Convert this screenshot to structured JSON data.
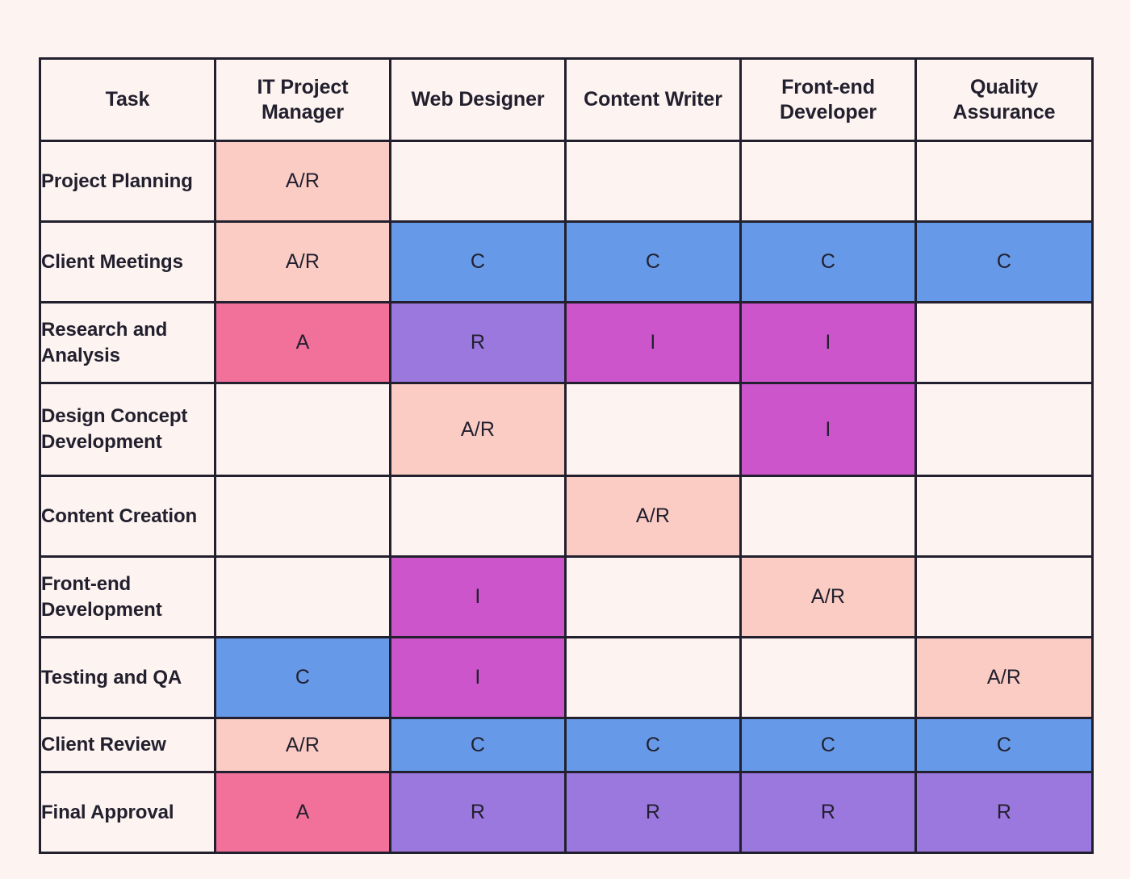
{
  "page": {
    "background_color": "#FDF3F0",
    "border_color": "#22202E",
    "text_color": "#22202E"
  },
  "legend_colors": {
    "accountable_responsible": "#FBCCC4",
    "accountable": "#F2719B",
    "responsible": "#9B78DE",
    "informed": "#CC55CC",
    "consulted": "#6699E8",
    "empty": "#FDF3F0"
  },
  "chart_data": {
    "type": "table",
    "title": "",
    "columns": [
      "Task",
      "IT Project Manager",
      "Web Designer",
      "Content Writer",
      "Front-end Developer",
      "Quality Assurance"
    ],
    "rows": [
      {
        "task": "Project Planning",
        "lines": 2,
        "cells": [
          {
            "value": "A/R",
            "code": "AR"
          },
          {
            "value": "",
            "code": "empty"
          },
          {
            "value": "",
            "code": "empty"
          },
          {
            "value": "",
            "code": "empty"
          },
          {
            "value": "",
            "code": "empty"
          }
        ]
      },
      {
        "task": "Client Meetings",
        "lines": 2,
        "cells": [
          {
            "value": "A/R",
            "code": "AR"
          },
          {
            "value": "C",
            "code": "C"
          },
          {
            "value": "C",
            "code": "C"
          },
          {
            "value": "C",
            "code": "C"
          },
          {
            "value": "C",
            "code": "C"
          }
        ]
      },
      {
        "task": "Research and Analysis",
        "lines": 2,
        "cells": [
          {
            "value": "A",
            "code": "A"
          },
          {
            "value": "R",
            "code": "R"
          },
          {
            "value": "I",
            "code": "I"
          },
          {
            "value": "I",
            "code": "I"
          },
          {
            "value": "",
            "code": "empty"
          }
        ]
      },
      {
        "task": "Design Concept Development",
        "lines": 3,
        "cells": [
          {
            "value": "",
            "code": "empty"
          },
          {
            "value": "A/R",
            "code": "AR"
          },
          {
            "value": "",
            "code": "empty"
          },
          {
            "value": "I",
            "code": "I"
          },
          {
            "value": "",
            "code": "empty"
          }
        ]
      },
      {
        "task": "Content Creation",
        "lines": 2,
        "cells": [
          {
            "value": "",
            "code": "empty"
          },
          {
            "value": "",
            "code": "empty"
          },
          {
            "value": "A/R",
            "code": "AR"
          },
          {
            "value": "",
            "code": "empty"
          },
          {
            "value": "",
            "code": "empty"
          }
        ]
      },
      {
        "task": "Front-end Development",
        "lines": 2,
        "cells": [
          {
            "value": "",
            "code": "empty"
          },
          {
            "value": "I",
            "code": "I"
          },
          {
            "value": "",
            "code": "empty"
          },
          {
            "value": "A/R",
            "code": "AR"
          },
          {
            "value": "",
            "code": "empty"
          }
        ]
      },
      {
        "task": "Testing and QA",
        "lines": 2,
        "cells": [
          {
            "value": "C",
            "code": "C"
          },
          {
            "value": "I",
            "code": "I"
          },
          {
            "value": "",
            "code": "empty"
          },
          {
            "value": "",
            "code": "empty"
          },
          {
            "value": "A/R",
            "code": "AR"
          }
        ]
      },
      {
        "task": "Client Review",
        "lines": 1,
        "cells": [
          {
            "value": "A/R",
            "code": "AR"
          },
          {
            "value": "C",
            "code": "C"
          },
          {
            "value": "C",
            "code": "C"
          },
          {
            "value": "C",
            "code": "C"
          },
          {
            "value": "C",
            "code": "C"
          }
        ]
      },
      {
        "task": "Final Approval",
        "lines": 2,
        "cells": [
          {
            "value": "A",
            "code": "A"
          },
          {
            "value": "R",
            "code": "R"
          },
          {
            "value": "R",
            "code": "R"
          },
          {
            "value": "R",
            "code": "R"
          },
          {
            "value": "R",
            "code": "R"
          }
        ]
      }
    ]
  }
}
